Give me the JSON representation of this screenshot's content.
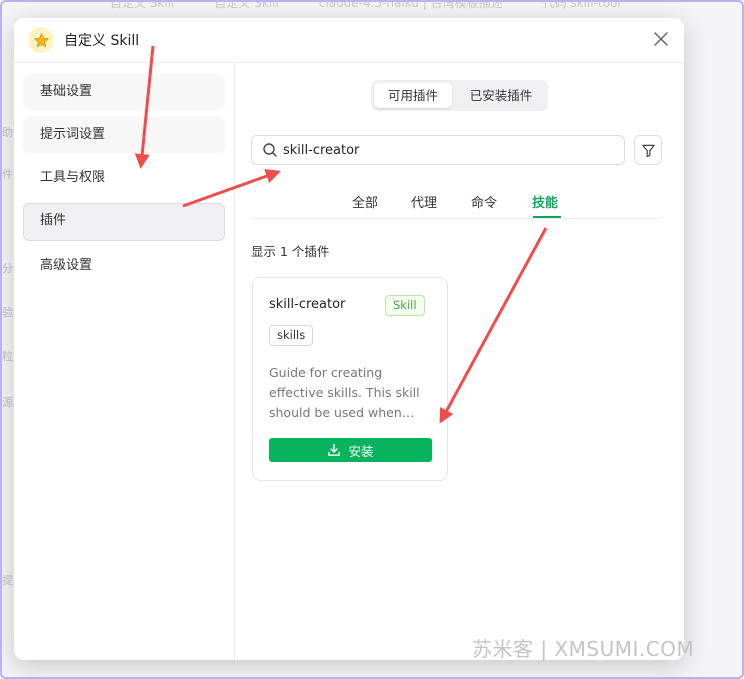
{
  "background": {
    "tabs": [
      "自定义 Skill",
      "自定义 Skill",
      "claude-4.5-haiku | 台湾模板描述",
      "代码 skill-tool"
    ],
    "side_chars": [
      "助",
      "件",
      "分",
      "验",
      "粒",
      "源",
      "提"
    ]
  },
  "dialog": {
    "title": "自定义 Skill",
    "logo_icon": "star-icon",
    "close_icon": "close-icon"
  },
  "sidebar": {
    "items": [
      {
        "label": "基础设置"
      },
      {
        "label": "提示词设置"
      },
      {
        "label": "工具与权限"
      },
      {
        "label": "插件"
      },
      {
        "label": "高级设置"
      }
    ],
    "active_index": 3
  },
  "segment": {
    "options": [
      "可用插件",
      "已安装插件"
    ],
    "active": "可用插件"
  },
  "search": {
    "value": "skill-creator",
    "icon": "search-icon",
    "filter_icon": "filter-icon"
  },
  "category_tabs": {
    "items": [
      "全部",
      "代理",
      "命令",
      "技能"
    ],
    "active": "技能",
    "accent_color": "#14a661"
  },
  "results": {
    "count_text": "显示 1 个插件"
  },
  "plugin_card": {
    "name": "skill-creator",
    "type_badge": "Skill",
    "tag": "skills",
    "description": "Guide for creating effective skills. This skill should be used when…",
    "install_label": "安装",
    "install_icon": "download-icon",
    "install_color": "#07b35c"
  },
  "watermark": "苏米客 | XMSUMI.COM",
  "annotation_color": "#ef4d4d"
}
